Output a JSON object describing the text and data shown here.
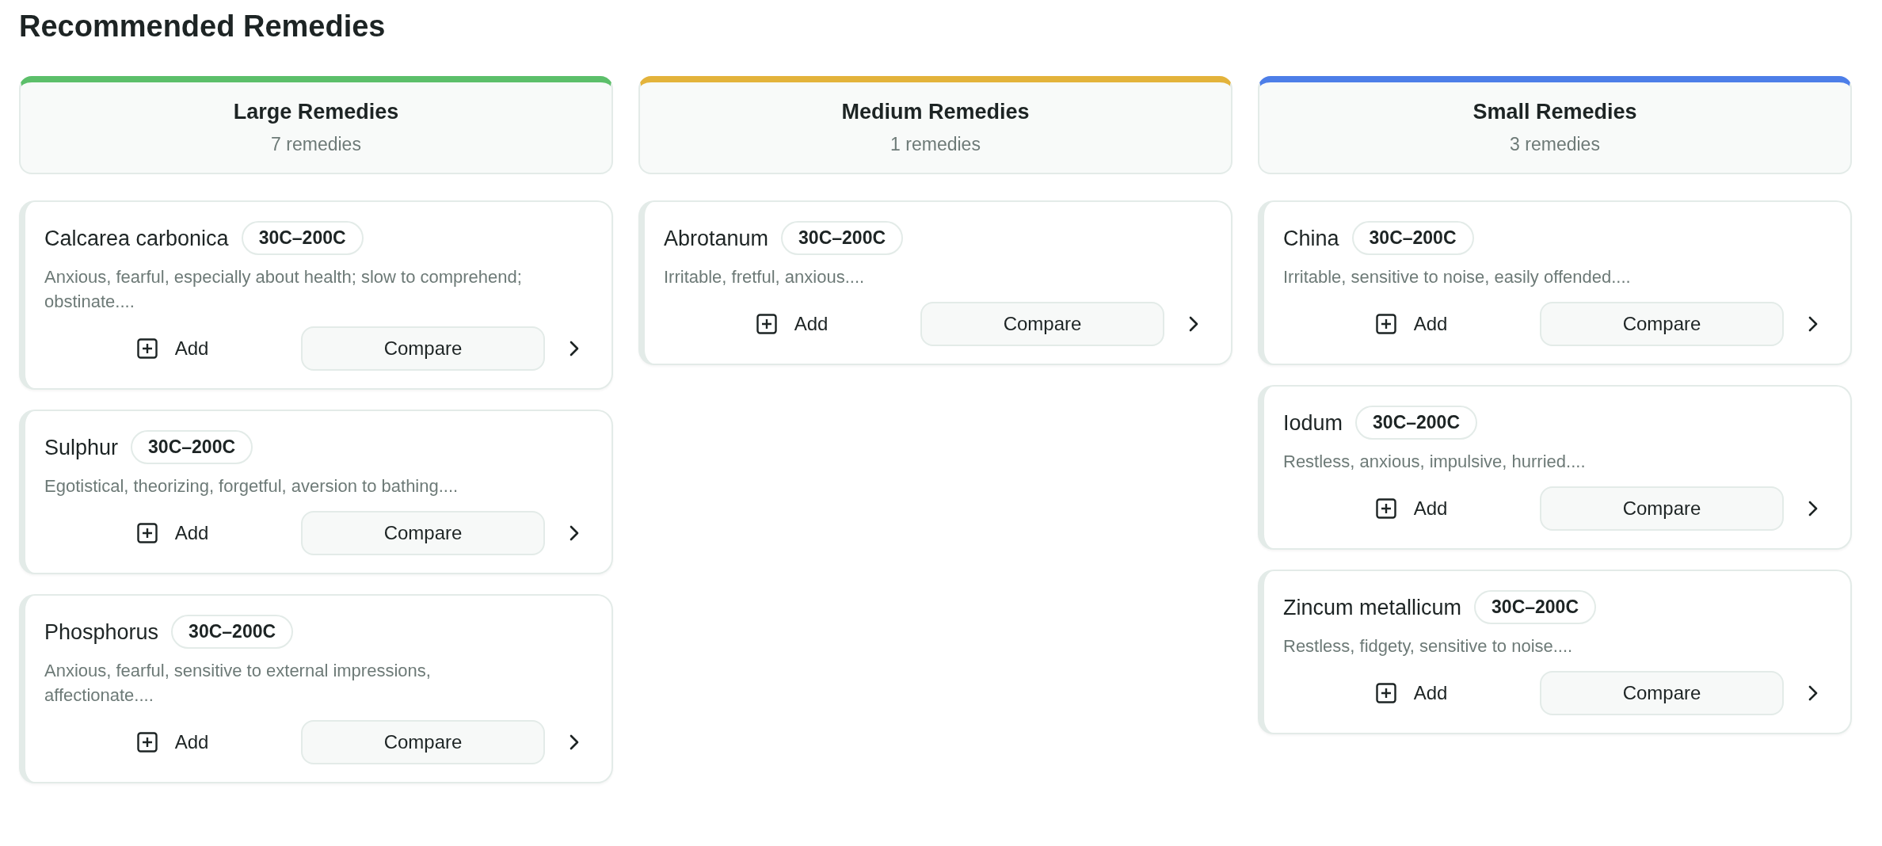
{
  "title": "Recommended Remedies",
  "columns": [
    {
      "title": "Large Remedies",
      "count": "7 remedies",
      "color": "#5cbf6a",
      "cards": [
        {
          "name": "Calcarea carbonica",
          "potency": "30C–200C",
          "description": "Anxious, fearful, especially about health; slow to comprehend; obstinate....",
          "add": "Add",
          "compare": "Compare"
        },
        {
          "name": "Sulphur",
          "potency": "30C–200C",
          "description": "Egotistical, theorizing, forgetful, aversion to bathing....",
          "add": "Add",
          "compare": "Compare"
        },
        {
          "name": "Phosphorus",
          "potency": "30C–200C",
          "description": "Anxious, fearful, sensitive to external impressions, affectionate....",
          "add": "Add",
          "compare": "Compare"
        }
      ]
    },
    {
      "title": "Medium Remedies",
      "count": "1 remedies",
      "color": "#e3b33b",
      "cards": [
        {
          "name": "Abrotanum",
          "potency": "30C–200C",
          "description": "Irritable, fretful, anxious....",
          "add": "Add",
          "compare": "Compare"
        }
      ]
    },
    {
      "title": "Small Remedies",
      "count": "3 remedies",
      "color": "#4d7ee8",
      "cards": [
        {
          "name": "China",
          "potency": "30C–200C",
          "description": "Irritable, sensitive to noise, easily offended....",
          "add": "Add",
          "compare": "Compare"
        },
        {
          "name": "Iodum",
          "potency": "30C–200C",
          "description": "Restless, anxious, impulsive, hurried....",
          "add": "Add",
          "compare": "Compare"
        },
        {
          "name": "Zincum metallicum",
          "potency": "30C–200C",
          "description": "Restless, fidgety, sensitive to noise....",
          "add": "Add",
          "compare": "Compare"
        }
      ]
    }
  ]
}
